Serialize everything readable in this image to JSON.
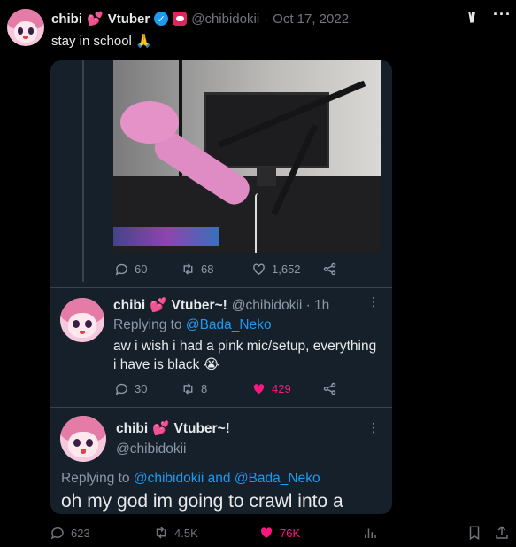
{
  "header": {
    "display_name": "chibi",
    "name_suffix": "Vtuber",
    "name_emoji": "💕",
    "handle": "@chibidokii",
    "separator": "·",
    "date": "Oct 17, 2022",
    "grok_label": "\\//",
    "more_label": "···"
  },
  "post": {
    "text": "stay in school 🙏"
  },
  "card": {
    "photo_actions": {
      "replies": "60",
      "retweets": "68",
      "likes": "1,652"
    },
    "reply": {
      "display_name": "chibi",
      "name_emoji": "💕",
      "name_suffix": "Vtuber~!",
      "handle_time": "@chibidokii · 1h",
      "replying_prefix": "Replying to ",
      "replying_to": "@Bada_Neko",
      "text": "aw i wish i had a pink mic/setup, everything i have is black 😭",
      "replies": "30",
      "retweets": "8",
      "likes": "429"
    },
    "main": {
      "display_name": "chibi",
      "name_emoji": "💕",
      "name_suffix": "Vtuber~!",
      "handle": "@chibidokii",
      "replying_prefix": "Replying to ",
      "replying_to": "@chibidokii and @Bada_Neko",
      "text": "oh my god im going to crawl into a"
    }
  },
  "stats": {
    "replies": "623",
    "reposts": "4.5K",
    "likes": "76K"
  },
  "colors": {
    "accent": "#1d9bf0",
    "like": "#f91880",
    "card_bg": "#15202b",
    "muted": "#71767b"
  }
}
